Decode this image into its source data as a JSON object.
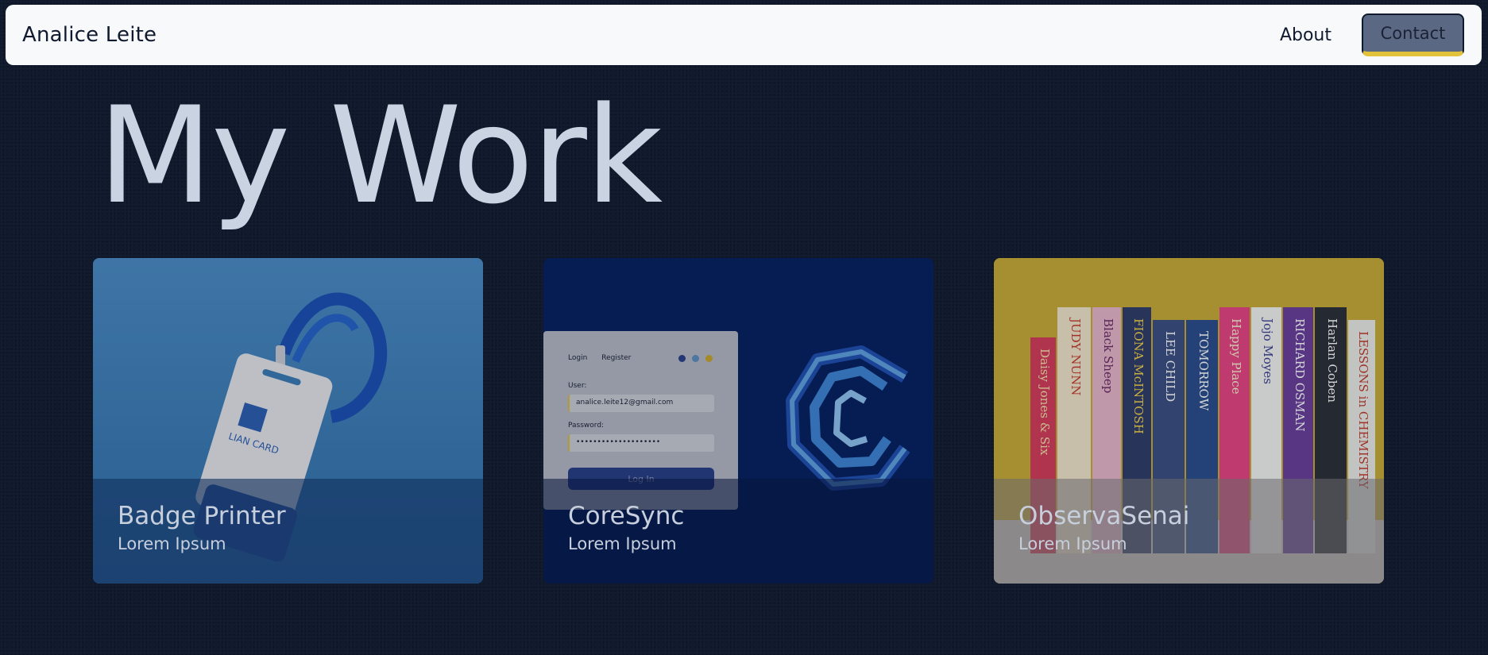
{
  "nav": {
    "brand": "Analice Leite",
    "about_label": "About",
    "contact_label": "Contact"
  },
  "hero": {
    "title": "My Work"
  },
  "cards": [
    {
      "title": "Badge Printer",
      "subtitle": "Lorem Ipsum",
      "badge_text": "LIAN CARD"
    },
    {
      "title": "CoreSync",
      "subtitle": "Lorem Ipsum",
      "login": {
        "tab_login": "Login",
        "tab_register": "Register",
        "user_label": "User:",
        "user_value": "analice.leite12@gmail.com",
        "password_label": "Password:",
        "password_value": "••••••••••••••••••••",
        "button_label": "Log In"
      }
    },
    {
      "title": "ObservaSenai",
      "subtitle": "Lorem Ipsum",
      "books": [
        "Daisy Jones & Six",
        "JUDY NUNN",
        "Black Sheep",
        "FIONA McINTOSH",
        "LEE CHILD",
        "TOMORROW",
        "Happy Place",
        "Jojo Moyes",
        "RICHARD OSMAN",
        "Harlan Coben",
        "LESSONS in CHEMISTRY"
      ]
    }
  ],
  "colors": {
    "background": "#101a2c",
    "navbar": "#f8f9fb",
    "title": "#c9d3e2",
    "contact_button": "#5b6883",
    "accent_yellow": "#e2c23a"
  }
}
